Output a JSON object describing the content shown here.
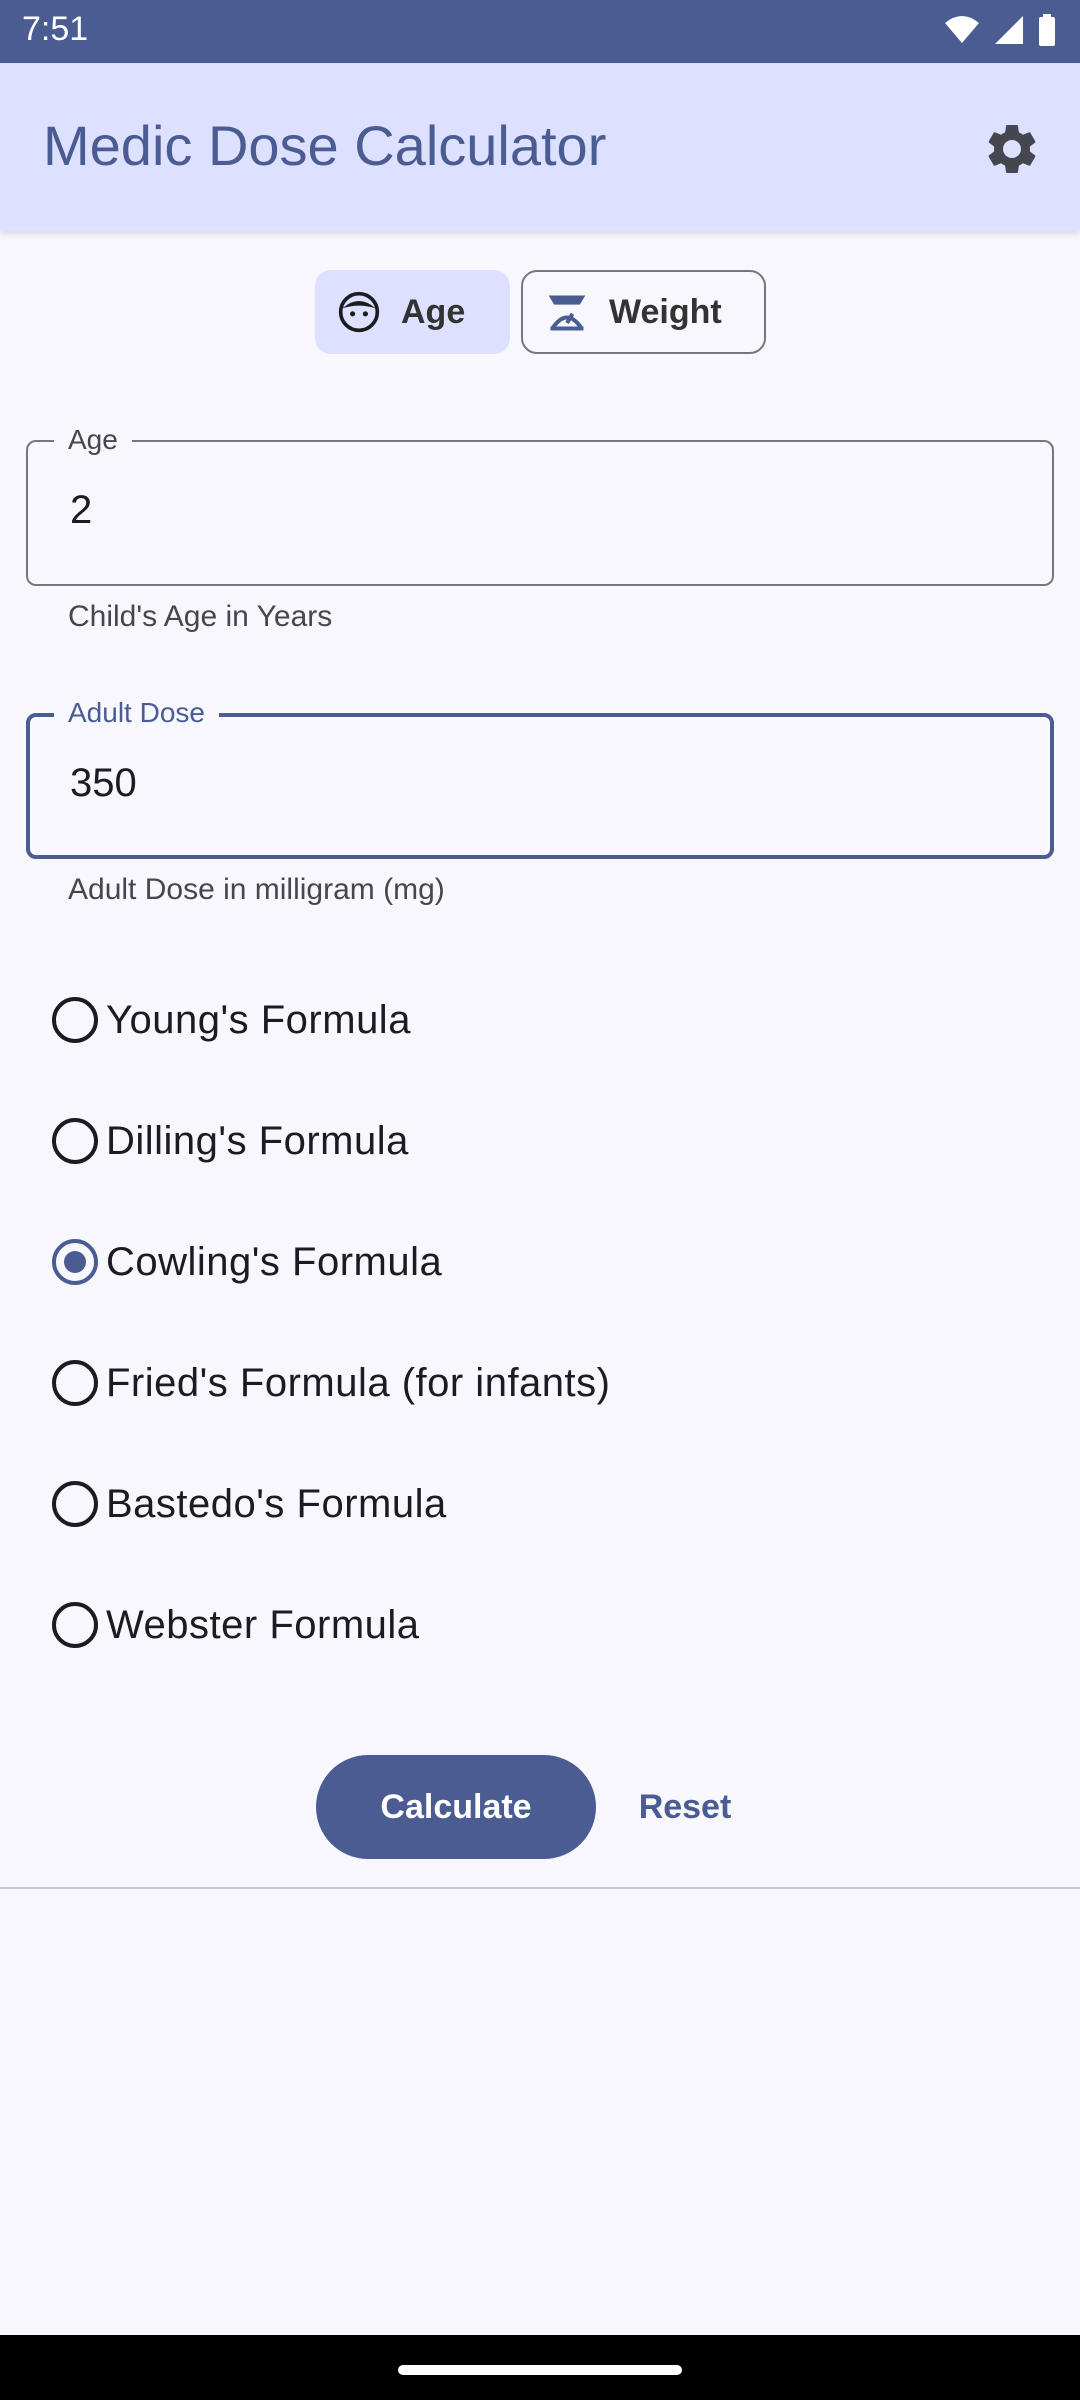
{
  "status_bar": {
    "time": "7:51",
    "icons": [
      "wifi-icon",
      "signal-icon",
      "battery-icon"
    ]
  },
  "app_bar": {
    "title": "Medic Dose Calculator",
    "settings_icon": "gear-icon"
  },
  "mode_toggle": {
    "age_label": "Age",
    "age_icon": "child-face-icon",
    "weight_label": "Weight",
    "weight_icon": "scale-icon",
    "selected": "Age"
  },
  "age_field": {
    "label": "Age",
    "value": "2",
    "helper": "Child's Age in Years"
  },
  "adult_dose_field": {
    "label": "Adult Dose",
    "value": "350",
    "helper": "Adult Dose in milligram (mg)",
    "focused": true
  },
  "formulas": [
    {
      "label": "Young's Formula",
      "checked": false
    },
    {
      "label": "Dilling's Formula",
      "checked": false
    },
    {
      "label": "Cowling's Formula",
      "checked": true
    },
    {
      "label": "Fried's Formula (for infants)",
      "checked": false
    },
    {
      "label": "Bastedo's Formula",
      "checked": false
    },
    {
      "label": "Webster Formula",
      "checked": false
    }
  ],
  "actions": {
    "calculate_label": "Calculate",
    "reset_label": "Reset"
  },
  "colors": {
    "primary": "#4A5C92",
    "primary_container": "#DDE1FF",
    "background": "#F8F7FD",
    "outline": "#75777F"
  }
}
